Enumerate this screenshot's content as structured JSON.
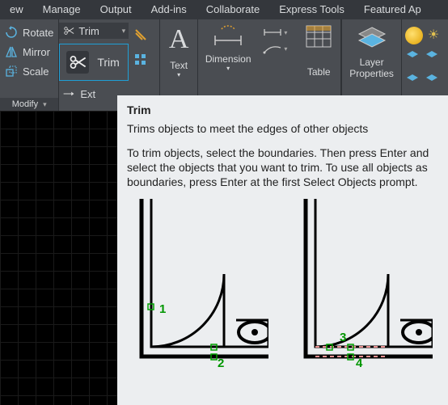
{
  "menu": {
    "items": [
      "ew",
      "Manage",
      "Output",
      "Add-ins",
      "Collaborate",
      "Express Tools",
      "Featured Ap"
    ]
  },
  "ribbon": {
    "modify": {
      "rotate": "Rotate",
      "mirror": "Mirror",
      "scale": "Scale",
      "title": "Modify"
    },
    "trim": {
      "top_label": "Trim",
      "dropdown_label": "Trim",
      "ext_label": "Ext"
    },
    "text": {
      "label": "Text"
    },
    "dimension": {
      "label": "Dimension"
    },
    "table": {
      "label": "Table"
    },
    "layer": {
      "label_line1": "Layer",
      "label_line2": "Properties"
    }
  },
  "tooltip": {
    "title": "Trim",
    "summary": "Trims objects to meet the edges of other objects",
    "body": "To trim objects, select the boundaries. Then press Enter and select the objects that you want to trim. To use all objects as boundaries, press Enter at the first Select Objects prompt.",
    "fig1": {
      "n1": "1",
      "n2": "2"
    },
    "fig2": {
      "n3": "3",
      "n4": "4"
    }
  }
}
